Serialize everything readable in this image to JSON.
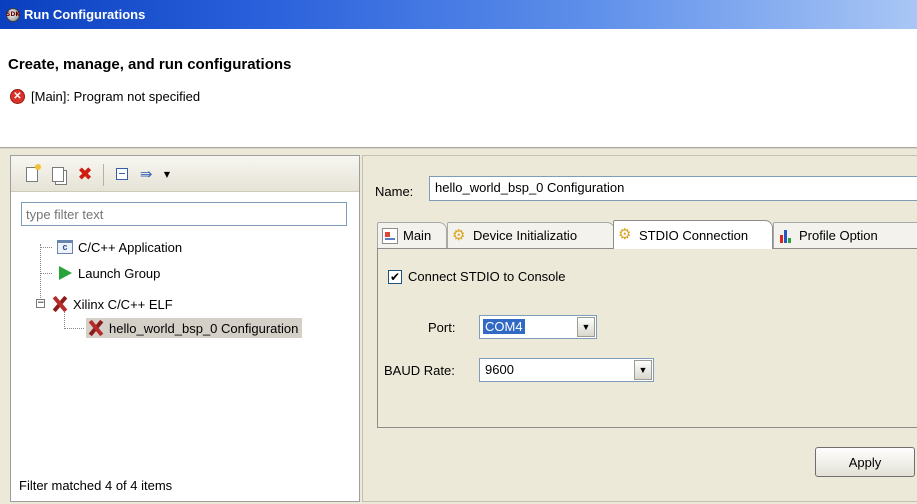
{
  "window": {
    "title": "Run Configurations",
    "icon": "sdk-app-icon"
  },
  "header": {
    "title": "Create, manage, and run configurations",
    "error_message": "[Main]: Program not specified"
  },
  "left_panel": {
    "toolbar": {
      "new_icon": "new-configuration-icon",
      "duplicate_icon": "duplicate-icon",
      "delete_icon": "delete-icon",
      "collapse_icon": "collapse-all-icon",
      "filter_icon": "filter-icon"
    },
    "filter_placeholder": "type filter text",
    "tree": [
      {
        "label": "C/C++ Application",
        "icon": "c-app-icon",
        "level": 1
      },
      {
        "label": "Launch Group",
        "icon": "launch-group-icon",
        "level": 1
      },
      {
        "label": "Xilinx C/C++ ELF",
        "icon": "xilinx-icon",
        "level": 1,
        "expanded": true
      },
      {
        "label": "hello_world_bsp_0 Configuration",
        "icon": "xilinx-icon",
        "level": 2,
        "selected": true
      }
    ],
    "status": "Filter matched 4 of 4 items"
  },
  "right_panel": {
    "name_label": "Name:",
    "name_value": "hello_world_bsp_0 Configuration",
    "tabs": [
      {
        "label": "Main",
        "active": false
      },
      {
        "label": "Device Initializatio",
        "active": false
      },
      {
        "label": "STDIO Connection",
        "active": true
      },
      {
        "label": "Profile Option",
        "active": false
      }
    ],
    "stdio": {
      "connect_label": "Connect STDIO to Console",
      "connect_checked": true,
      "port_label": "Port:",
      "port_value": "COM4",
      "baud_label": "BAUD Rate:",
      "baud_value": "9600"
    },
    "apply_label": "Apply"
  },
  "colors": {
    "titlebar": "#0a3fbf",
    "panel_bg": "#ece9d8",
    "selection": "#316ac5",
    "error": "#d8322b"
  }
}
